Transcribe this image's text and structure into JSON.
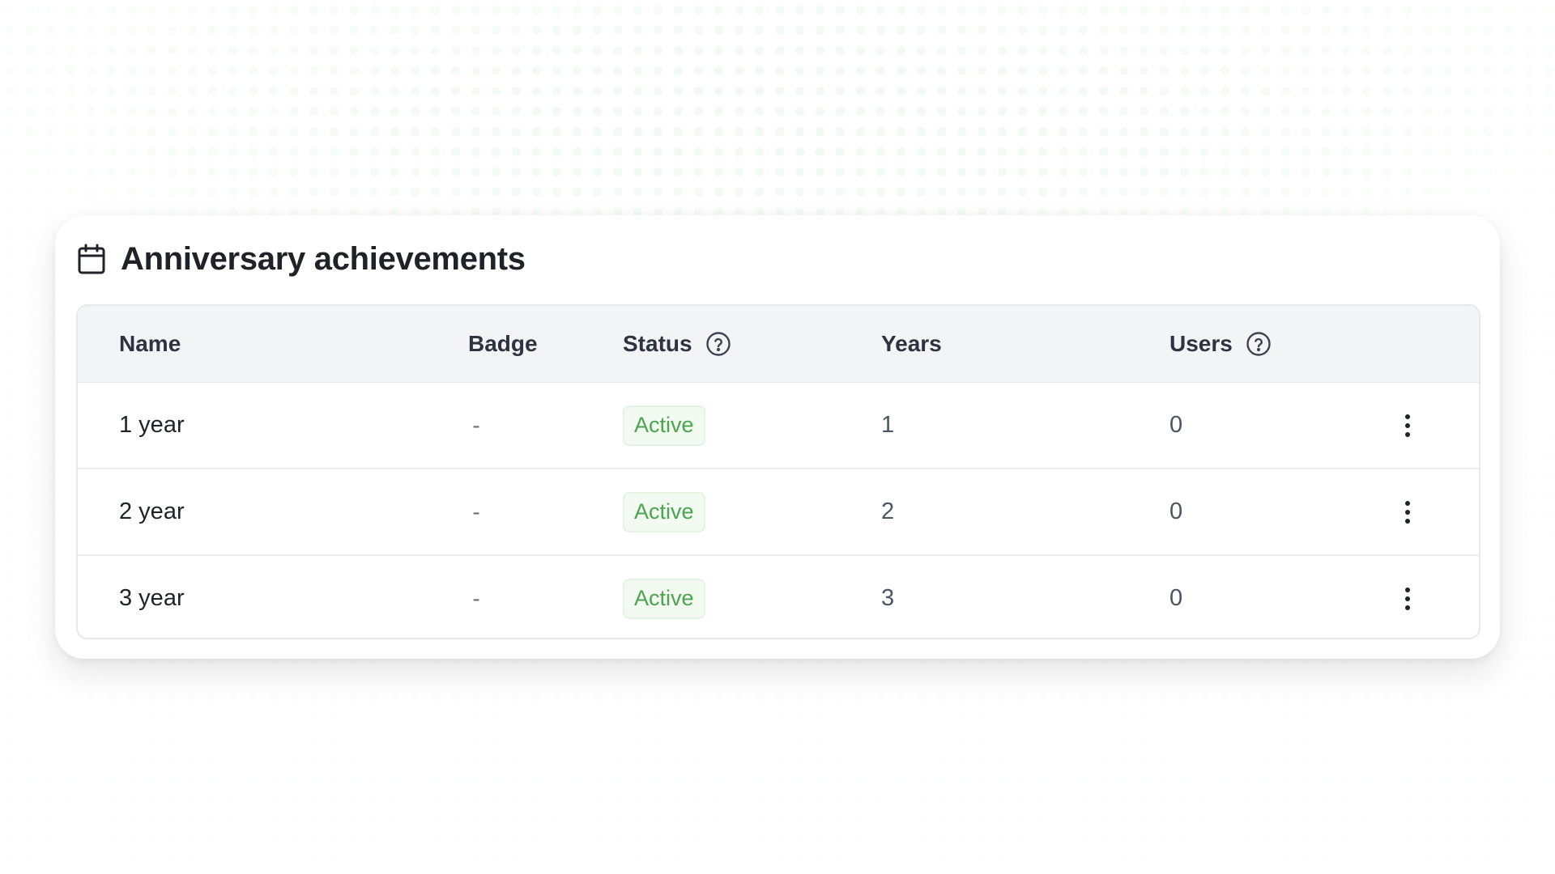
{
  "card": {
    "title": "Anniversary achievements",
    "title_icon": "calendar-icon"
  },
  "table": {
    "columns": [
      {
        "label": "Name",
        "help": false
      },
      {
        "label": "Badge",
        "help": false
      },
      {
        "label": "Status",
        "help": true,
        "help_icon": "help-circle-icon"
      },
      {
        "label": "Years",
        "help": false
      },
      {
        "label": "Users",
        "help": true,
        "help_icon": "help-circle-icon"
      }
    ],
    "rows": [
      {
        "name": "1 year",
        "badge": "-",
        "status": "Active",
        "years": "1",
        "users": "0",
        "actions_icon": "more-vertical-icon"
      },
      {
        "name": "2 year",
        "badge": "-",
        "status": "Active",
        "years": "2",
        "users": "0",
        "actions_icon": "more-vertical-icon"
      },
      {
        "name": "3 year",
        "badge": "-",
        "status": "Active",
        "years": "3",
        "users": "0",
        "actions_icon": "more-vertical-icon"
      }
    ]
  },
  "colors": {
    "status_active_text": "#4aa64e",
    "status_active_bg": "#f2faf2",
    "header_bg": "#f3f4f6",
    "background_dots": "#60be6e"
  }
}
